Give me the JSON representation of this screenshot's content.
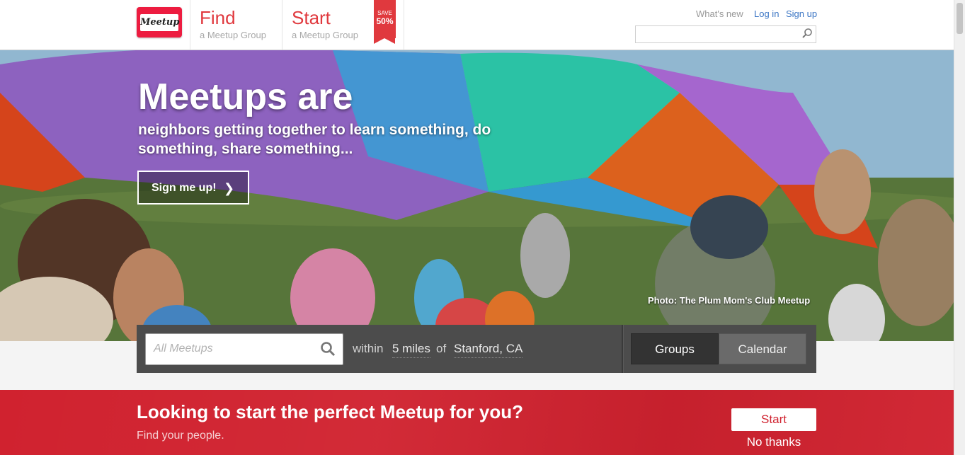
{
  "header": {
    "logo_text": "Meetup",
    "find": {
      "title": "Find",
      "subtitle": "a Meetup Group"
    },
    "start": {
      "title": "Start",
      "subtitle": "a Meetup Group"
    },
    "ribbon": {
      "line1": "SAVE",
      "line2": "50%"
    },
    "links": {
      "whats_new": "What's new",
      "login": "Log in",
      "signup": "Sign up"
    },
    "search_placeholder": ""
  },
  "hero": {
    "title": "Meetups are",
    "subtitle": "neighbors getting together to learn something, do something, share something...",
    "signup_button": "Sign me up!",
    "photo_credit": "Photo: The Plum Mom's Club Meetup"
  },
  "search": {
    "placeholder": "All Meetups",
    "within": "within",
    "distance": "5 miles",
    "of": "of",
    "location": "Stanford, CA",
    "tabs": [
      {
        "label": "Groups",
        "selected": true
      },
      {
        "label": "Calendar",
        "selected": false
      }
    ]
  },
  "promo": {
    "title": "Looking to start the perfect Meetup for you?",
    "subtitle": "Find your people.",
    "start_button": "Start",
    "no_thanks": "No thanks"
  },
  "colors": {
    "brand_red": "#e0393e",
    "promo_red": "#d0222f",
    "link_blue": "#3a75c4"
  }
}
